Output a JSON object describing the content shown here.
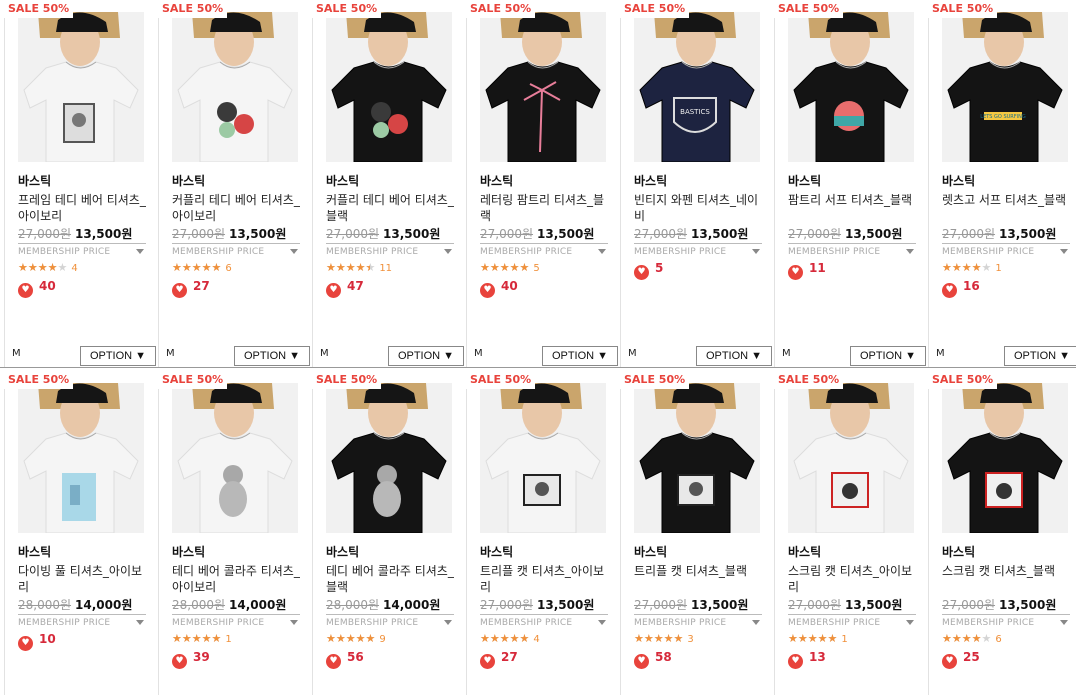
{
  "colors": {
    "sale": "#e8433c",
    "heart": "#e8433c",
    "star": "#f0903a"
  },
  "labels": {
    "membership": "MEMBERSHIP PRICE",
    "option": "OPTION ▼",
    "size": "M",
    "stars": "★★★★★"
  },
  "rows": [
    {
      "products": [
        {
          "badge": "SALE 50%",
          "brand": "바스틱",
          "name": "프레임 테디 베어 티셔츠_아이보리",
          "orig": "27,000원",
          "sale": "13,500원",
          "rating": 4,
          "reviews": "4",
          "likes": "40",
          "shirt": "#f5f5f5",
          "print": "frame"
        },
        {
          "badge": "SALE 50%",
          "brand": "바스틱",
          "name": "커플리 테디 베어 티셔츠_아이보리",
          "orig": "27,000원",
          "sale": "13,500원",
          "rating": 5,
          "reviews": "6",
          "likes": "27",
          "shirt": "#f5f5f5",
          "print": "bears"
        },
        {
          "badge": "SALE 50%",
          "brand": "바스틱",
          "name": "커플리 테디 베어 티셔츠_블랙",
          "orig": "27,000원",
          "sale": "13,500원",
          "rating": 4.5,
          "reviews": "11",
          "likes": "47",
          "shirt": "#141414",
          "print": "bears"
        },
        {
          "badge": "SALE 50%",
          "brand": "바스틱",
          "name": "레터링 팜트리 티셔츠_블랙",
          "orig": "27,000원",
          "sale": "13,500원",
          "rating": 5,
          "reviews": "5",
          "likes": "40",
          "shirt": "#141414",
          "print": "palm"
        },
        {
          "badge": "SALE 50%",
          "brand": "바스틱",
          "name": "빈티지 와펜 티셔츠_네이비",
          "orig": "27,000원",
          "sale": "13,500원",
          "rating": null,
          "reviews": "",
          "likes": "5",
          "shirt": "#1d2340",
          "print": "crest"
        },
        {
          "badge": "SALE 50%",
          "brand": "바스틱",
          "name": "팜트리 서프 티셔츠_블랙",
          "orig": "27,000원",
          "sale": "13,500원",
          "rating": null,
          "reviews": "",
          "likes": "11",
          "shirt": "#141414",
          "print": "sunset"
        },
        {
          "badge": "SALE 50%",
          "brand": "바스틱",
          "name": "렛츠고 서프 티셔츠_블랙",
          "orig": "27,000원",
          "sale": "13,500원",
          "rating": 4,
          "reviews": "1",
          "likes": "16",
          "shirt": "#141414",
          "print": "surf"
        }
      ]
    },
    {
      "products": [
        {
          "badge": "SALE 50%",
          "brand": "바스틱",
          "name": "다이빙 풀 티셔츠_아이보리",
          "orig": "28,000원",
          "sale": "14,000원",
          "rating": null,
          "reviews": "",
          "likes": "10",
          "shirt": "#f5f5f5",
          "print": "pool"
        },
        {
          "badge": "SALE 50%",
          "brand": "바스틱",
          "name": "테디 베어 콜라주 티셔츠_아이보리",
          "orig": "28,000원",
          "sale": "14,000원",
          "rating": 5,
          "reviews": "1",
          "likes": "39",
          "shirt": "#f5f5f5",
          "print": "teddy"
        },
        {
          "badge": "SALE 50%",
          "brand": "바스틱",
          "name": "테디 베어 콜라주 티셔츠_블랙",
          "orig": "28,000원",
          "sale": "14,000원",
          "rating": 5,
          "reviews": "9",
          "likes": "56",
          "shirt": "#141414",
          "print": "teddy"
        },
        {
          "badge": "SALE 50%",
          "brand": "바스틱",
          "name": "트리플 캣 티셔츠_아이보리",
          "orig": "27,000원",
          "sale": "13,500원",
          "rating": 5,
          "reviews": "4",
          "likes": "27",
          "shirt": "#f5f5f5",
          "print": "cats"
        },
        {
          "badge": "SALE 50%",
          "brand": "바스틱",
          "name": "트리플 캣 티셔츠_블랙",
          "orig": "27,000원",
          "sale": "13,500원",
          "rating": 5,
          "reviews": "3",
          "likes": "58",
          "shirt": "#141414",
          "print": "cats"
        },
        {
          "badge": "SALE 50%",
          "brand": "바스틱",
          "name": "스크림 캣 티셔츠_아이보리",
          "orig": "27,000원",
          "sale": "13,500원",
          "rating": 5,
          "reviews": "1",
          "likes": "13",
          "shirt": "#f5f5f5",
          "print": "scream"
        },
        {
          "badge": "SALE 50%",
          "brand": "바스틱",
          "name": "스크림 캣 티셔츠_블랙",
          "orig": "27,000원",
          "sale": "13,500원",
          "rating": 4,
          "reviews": "6",
          "likes": "25",
          "shirt": "#141414",
          "print": "scream"
        }
      ]
    }
  ]
}
